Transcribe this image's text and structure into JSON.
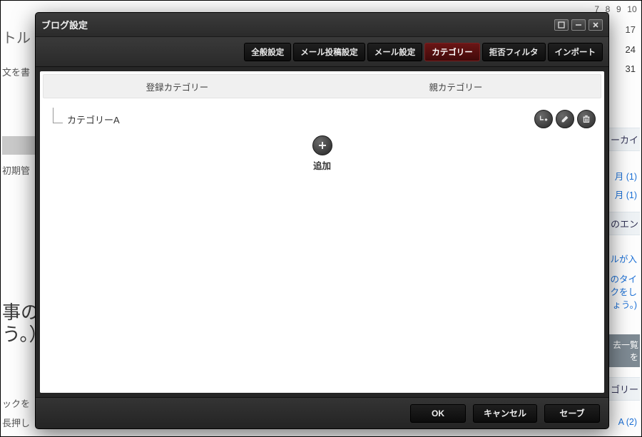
{
  "bg": {
    "left": {
      "title_frag": "トル",
      "body_hint": "文を書",
      "admin_frag": "初期管",
      "big_text": "事の\nう。）",
      "hint1": "ックを",
      "hint2": "長押し"
    },
    "right": {
      "cal_row1": [
        "7",
        "8",
        "9",
        "10"
      ],
      "cal_17": "17",
      "cal_24": "24",
      "cal_31": "31",
      "archive_header": "ーカイ",
      "archive_1": "月 (1)",
      "archive_2": "月 (1)",
      "entry_header": "のエン",
      "entry_1": "トルが入",
      "entry_2": "のタイ",
      "entry_3": "ックをし",
      "entry_4": "ょう。)",
      "list_button": "去一覧を",
      "category_header": "ゴリー",
      "category_1": "A (2)"
    }
  },
  "dialog": {
    "title": "ブログ設定",
    "tabs": [
      {
        "key": "general",
        "label": "全般設定"
      },
      {
        "key": "mailpost",
        "label": "メール投稿設定"
      },
      {
        "key": "mail",
        "label": "メール設定"
      },
      {
        "key": "category",
        "label": "カテゴリー",
        "active": true
      },
      {
        "key": "filter",
        "label": "拒否フィルタ"
      },
      {
        "key": "import",
        "label": "インポート"
      }
    ],
    "columns": {
      "registered": "登録カテゴリー",
      "parent": "親カテゴリー"
    },
    "rows": [
      {
        "name": "カテゴリーA"
      }
    ],
    "add_label": "追加",
    "footer": {
      "ok": "OK",
      "cancel": "キャンセル",
      "save": "セーブ"
    }
  }
}
